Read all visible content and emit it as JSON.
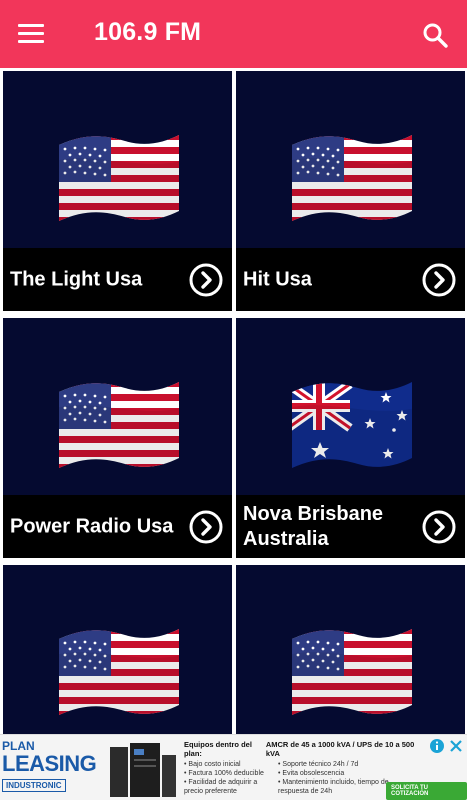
{
  "app": {
    "title": "106.9 FM",
    "accent_color": "#f2365a",
    "card_color": "#050a30"
  },
  "icons": {
    "menu": "hamburger-menu-icon",
    "search": "search-icon",
    "play": "chevron-right-circle-icon"
  },
  "stations": [
    {
      "name": "The Light Usa",
      "flag": "usa"
    },
    {
      "name": "Hit Usa",
      "flag": "usa"
    },
    {
      "name": "Power Radio Usa",
      "flag": "usa"
    },
    {
      "name": "Nova Brisbane Australia",
      "flag": "australia"
    },
    {
      "name": "",
      "flag": "usa"
    },
    {
      "name": "",
      "flag": "usa"
    }
  ],
  "ad": {
    "plan": "PLAN",
    "leasing": "LEASING",
    "company": "INDUSTRONIC",
    "headline_left": "Equipos dentro del plan:",
    "headline_right": "AMCR de 45 a 1000 kVA / UPS de 10 a 500 kVA",
    "bullets_left": [
      "Bajo costo inicial",
      "Factura 100% deducible",
      "Facilidad de adquirir a precio preferente"
    ],
    "bullets_right": [
      "Soporte técnico 24h / 7d",
      "Evita obsolescencia",
      "Mantenimiento incluido, tiempo de respuesta de 24h"
    ],
    "cta": "SOLICITA TU COTIZACIÓN"
  }
}
